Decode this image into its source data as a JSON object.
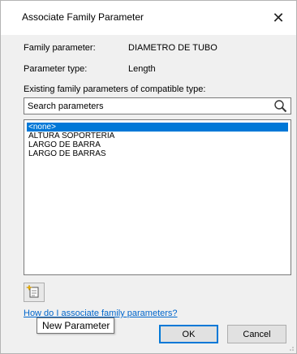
{
  "window": {
    "title": "Associate Family Parameter",
    "close_glyph": "✕"
  },
  "info": {
    "family_parameter_label": "Family parameter:",
    "family_parameter_value": "DIAMETRO DE TUBO",
    "parameter_type_label": "Parameter type:",
    "parameter_type_value": "Length",
    "existing_label": "Existing family parameters of compatible type:"
  },
  "search": {
    "placeholder": "Search parameters",
    "icon": "search-icon"
  },
  "parameter_list": {
    "items": [
      "<none>",
      "ALTURA SOPORTERIA",
      "LARGO DE BARRA",
      "LARGO DE BARRAS"
    ],
    "selected_index": 0
  },
  "toolbar": {
    "new_parameter_icon": "new-parameter-icon",
    "tooltip": "New Parameter"
  },
  "help": {
    "link_text": "How do I associate family parameters?"
  },
  "buttons": {
    "ok": "OK",
    "cancel": "Cancel"
  },
  "colors": {
    "selection": "#0078d7",
    "link": "#0066cc"
  }
}
